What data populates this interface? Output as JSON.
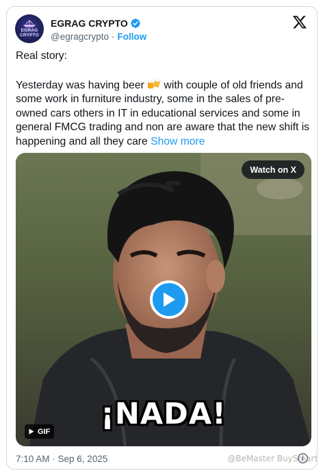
{
  "author": {
    "avatar_text": "EGRAG CRYPTO",
    "display_name": "EGRAG CRYPTO",
    "handle": "@egragcrypto",
    "separator": "·",
    "follow_label": "Follow",
    "verified_color": "#1d9bf0"
  },
  "tweet": {
    "paragraph_1": "Real story:",
    "paragraph_2_before_emoji": "Yesterday was having beer ",
    "paragraph_2_after_emoji": " with couple of old friends and some work in furniture industry, some in the sales of pre-owned cars others in IT in educational services and some in general FMCG trading and non are aware that the new shift is happening and all they care ",
    "show_more_label": "Show more",
    "emoji": "beer-mugs-icon"
  },
  "media": {
    "watch_label": "Watch on X",
    "caption": "¡NADA!",
    "gif_label": "GIF"
  },
  "footer": {
    "timestamp": "7:10 AM · Sep 6, 2025"
  },
  "watermark": "@BeMaster BuySmart",
  "colors": {
    "accent": "#1d9bf0",
    "text": "#0f1419",
    "secondary": "#536471",
    "border": "#cfd9de"
  }
}
